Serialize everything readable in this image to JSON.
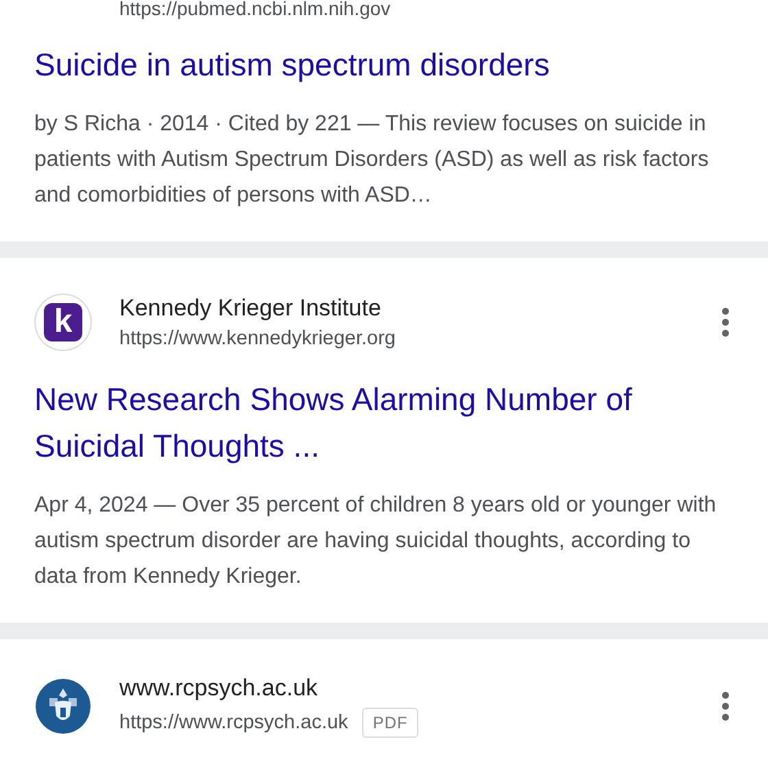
{
  "results": [
    {
      "kind": "cut",
      "url": "https://pubmed.ncbi.nlm.nih.gov",
      "title": "Suicide in autism spectrum disorders",
      "snippet": "by S Richa · 2014 · Cited by 221 — This review focuses on suicide in patients with Autism Spectrum Disorders (ASD) as well as risk factors and comorbidities of persons with ASD…"
    },
    {
      "kind": "letter",
      "logo_letter": "k",
      "site": "Kennedy Krieger Institute",
      "url": "https://www.kennedykrieger.org",
      "title": "New Research Shows Alarming Number of Suicidal Thoughts ...",
      "snippet": "Apr 4, 2024 — Over 35 percent of children 8 years old or younger with autism spectrum disorder are having suicidal thoughts, according to data from Kennedy Krieger."
    },
    {
      "kind": "crest",
      "site": "www.rcpsych.ac.uk",
      "url": "https://www.rcpsych.ac.uk",
      "tag": "PDF"
    }
  ]
}
